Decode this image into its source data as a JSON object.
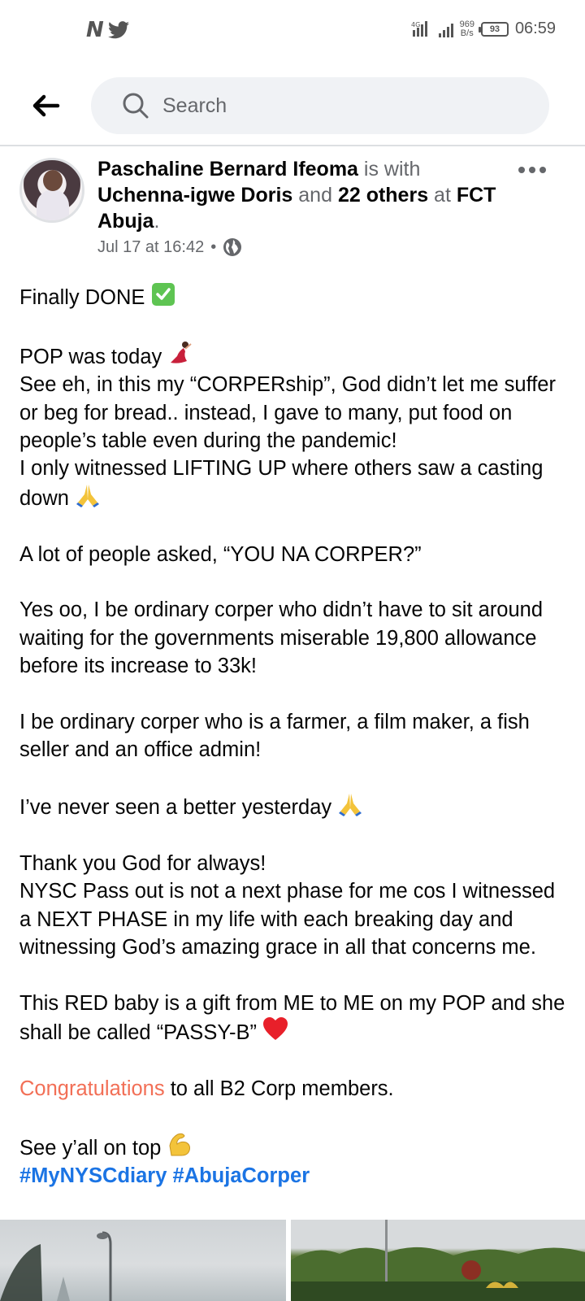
{
  "status_bar": {
    "app_logo": "N",
    "time": "06:59",
    "battery": "93",
    "net_speed_value": "969",
    "net_speed_unit": "B/s",
    "network": "4G"
  },
  "header": {
    "search_placeholder": "Search"
  },
  "post": {
    "author": "Paschaline Bernard Ifeoma",
    "with_text": " is with ",
    "tagged_person": "Uchenna-igwe Doris",
    "and_text": " and ",
    "others": "22 others",
    "at_text": " at ",
    "location": "FCT Abuja",
    "period": ".",
    "timestamp": "Jul 17 at 16:42",
    "audience_separator": "•",
    "body": {
      "p1": "Finally DONE",
      "p2_line1": "POP was today",
      "p2_rest": "See eh, in this my “CORPERship”, God didn’t let me suffer or beg for bread.. instead, I gave to many, put food on people’s table even during the pandemic!",
      "p2_line3": "I only witnessed LIFTING UP where others saw a casting down",
      "p3": "A lot of people asked, “YOU NA CORPER?”",
      "p4": "Yes oo, I be ordinary corper who didn’t have to sit around waiting for the governments miserable 19,800 allowance before its increase to 33k!",
      "p5": "I be ordinary corper who is a farmer, a film maker, a fish seller and an office admin!",
      "p6": "I’ve never seen a better yesterday",
      "p7_line1": "Thank you God for always!",
      "p7_rest": "NYSC Pass out is not a next phase for me cos I witnessed a NEXT PHASE in my life with each breaking day and witnessing God’s amazing grace in all that concerns me.",
      "p8": "This RED baby is a gift from ME to ME on my POP and she shall be called “PASSY-B”",
      "p9_highlight": "Congratulations",
      "p9_rest": " to all B2 Corp members.",
      "p10": "See y’all on top",
      "hashtag1": "#MyNYSCdiary",
      "hashtag2": "#AbujaCorper"
    }
  },
  "colors": {
    "highlight": "#f26f56",
    "hashtag": "#1b74e4",
    "secondary_text": "#65676b"
  }
}
